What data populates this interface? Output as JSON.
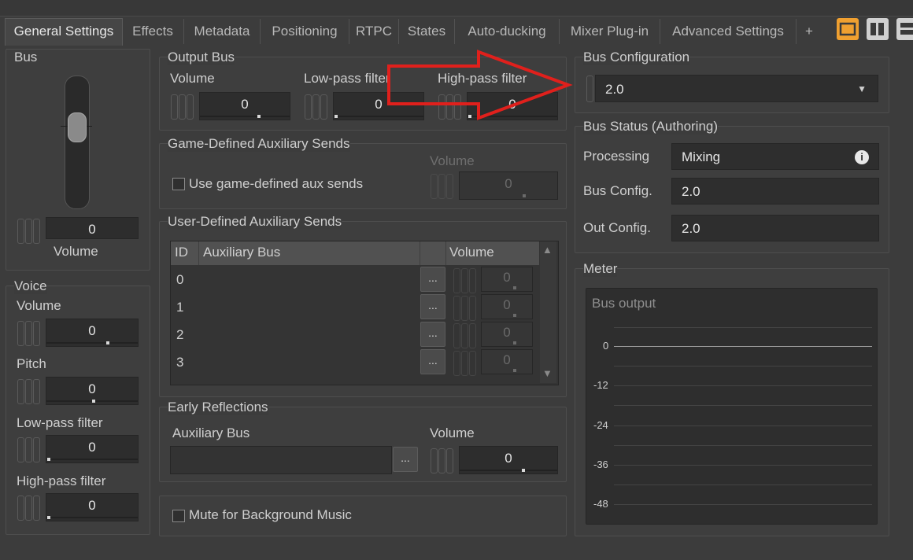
{
  "tabs": [
    "General Settings",
    "Effects",
    "Metadata",
    "Positioning",
    "RTPC",
    "States",
    "Auto-ducking",
    "Mixer Plug-in",
    "Advanced Settings",
    "+"
  ],
  "bus": {
    "label": "Bus",
    "volume_label": "Volume",
    "volume_value": "0"
  },
  "voice": {
    "label": "Voice",
    "volume_label": "Volume",
    "volume_value": "0",
    "pitch_label": "Pitch",
    "pitch_value": "0",
    "lpf_label": "Low-pass filter",
    "lpf_value": "0",
    "hpf_label": "High-pass filter",
    "hpf_value": "0"
  },
  "output_bus": {
    "label": "Output Bus",
    "volume_label": "Volume",
    "volume_value": "0",
    "lpf_label": "Low-pass filter",
    "lpf_value": "0",
    "hpf_label": "High-pass filter",
    "hpf_value": "0"
  },
  "game_aux": {
    "label": "Game-Defined Auxiliary Sends",
    "checkbox_label": "Use game-defined aux sends",
    "volume_label": "Volume",
    "volume_value": "0"
  },
  "user_aux": {
    "label": "User-Defined Auxiliary Sends",
    "headers": {
      "id": "ID",
      "bus": "Auxiliary Bus",
      "volume": "Volume"
    },
    "rows": [
      {
        "id": "0",
        "browse": "...",
        "volume": "0"
      },
      {
        "id": "1",
        "browse": "...",
        "volume": "0"
      },
      {
        "id": "2",
        "browse": "...",
        "volume": "0"
      },
      {
        "id": "3",
        "browse": "...",
        "volume": "0"
      }
    ]
  },
  "early_reflections": {
    "label": "Early Reflections",
    "aux_bus_label": "Auxiliary Bus",
    "browse": "...",
    "volume_label": "Volume",
    "volume_value": "0"
  },
  "mute_bg": {
    "label": "Mute for Background Music"
  },
  "bus_config": {
    "label": "Bus Configuration",
    "value": "2.0"
  },
  "bus_status": {
    "label": "Bus Status (Authoring)",
    "processing_label": "Processing",
    "processing_value": "Mixing",
    "bus_config_label": "Bus Config.",
    "bus_config_value": "2.0",
    "out_config_label": "Out Config.",
    "out_config_value": "2.0"
  },
  "meter": {
    "label": "Meter",
    "title": "Bus output",
    "ticks": [
      "0",
      "-12",
      "-24",
      "-36",
      "-48"
    ]
  },
  "colors": {
    "accent": "#f0a030",
    "annotation_arrow": "#e0201c"
  }
}
